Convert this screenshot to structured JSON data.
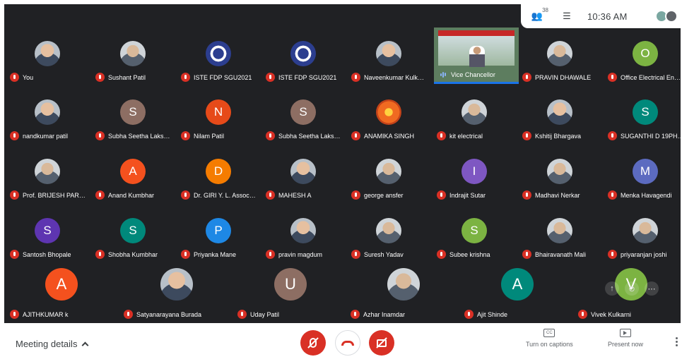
{
  "topbar": {
    "participants_icon": "people-icon",
    "participant_count": "38",
    "chat_icon": "chat-icon",
    "time": "10:36 AM",
    "self_avatars": [
      "#7aa7a1",
      "#5f6368"
    ]
  },
  "presenter": {
    "name": "Vice Chancellor",
    "icon": "speaking-eq-icon"
  },
  "participants": [
    {
      "name": "You",
      "avatar": "photo"
    },
    {
      "name": "Sushant Patil",
      "avatar": "gray-photo"
    },
    {
      "name": "ISTE FDP SGU2021",
      "avatar": "emblem"
    },
    {
      "name": "ISTE FDP SGU2021",
      "avatar": "emblem"
    },
    {
      "name": "Naveenkumar Kulk…",
      "avatar": "photo"
    },
    null,
    {
      "name": "PRAVIN DHAWALE",
      "avatar": "gray-photo"
    },
    {
      "name": "Office Electrical En…",
      "initial": "O",
      "color": "#7cb342"
    },
    {
      "name": "nandkumar patil",
      "avatar": "photo"
    },
    {
      "name": "Subha Seetha Laks…",
      "initial": "S",
      "color": "#8d6e63"
    },
    {
      "name": "Nilam Patil",
      "initial": "N",
      "color": "#e64a19"
    },
    {
      "name": "Subha Seetha Laks…",
      "initial": "S",
      "color": "#8d6e63"
    },
    {
      "name": "ANAMIKA SINGH",
      "avatar": "flower"
    },
    {
      "name": "kit electrical",
      "avatar": "gray-photo"
    },
    {
      "name": "Kshitij Bhargava",
      "avatar": "photo"
    },
    {
      "name": "SUGANTHI D 19PH…",
      "initial": "S",
      "color": "#00897b"
    },
    {
      "name": "Prof. BRIJESH PAR…",
      "avatar": "gray-photo"
    },
    {
      "name": "Anand Kumbhar",
      "initial": "A",
      "color": "#f4511e"
    },
    {
      "name": "Dr. GIRI Y. L. Assoc…",
      "initial": "D",
      "color": "#f57c00"
    },
    {
      "name": "MAHESH A",
      "avatar": "photo"
    },
    {
      "name": "george ansfer",
      "avatar": "gray-photo"
    },
    {
      "name": "Indrajit Sutar",
      "initial": "I",
      "color": "#7e57c2"
    },
    {
      "name": "Madhavi Nerkar",
      "avatar": "gray-photo"
    },
    {
      "name": "Menka Havagendi",
      "initial": "M",
      "color": "#5c6bc0"
    },
    {
      "name": "Santosh Bhopale",
      "initial": "S",
      "color": "#5e35b1"
    },
    {
      "name": "Shobha Kumbhar",
      "initial": "S",
      "color": "#00897b"
    },
    {
      "name": "Priyanka Mane",
      "initial": "P",
      "color": "#1e88e5"
    },
    {
      "name": "pravin magdum",
      "avatar": "photo"
    },
    {
      "name": "Suresh Yadav",
      "avatar": "gray-photo"
    },
    {
      "name": "Subee krishna",
      "initial": "S",
      "color": "#7cb342"
    },
    {
      "name": "Bhairavanath Mali",
      "avatar": "gray-photo"
    },
    {
      "name": "priyaranjan joshi",
      "avatar": "gray-photo"
    }
  ],
  "bottom_participants": [
    {
      "name": "AJITHKUMAR k",
      "initial": "A",
      "color": "#f4511e"
    },
    {
      "name": "Satyanarayana Burada",
      "avatar": "photo"
    },
    {
      "name": "Uday Patil",
      "initial": "U",
      "color": "#8d6e63"
    },
    {
      "name": "Azhar Inamdar",
      "avatar": "gray-photo"
    },
    {
      "name": "Ajit Shinde",
      "initial": "A",
      "color": "#00897b"
    },
    {
      "name": "Vivek Kulkarni",
      "initial": "V",
      "color": "#7cb342"
    }
  ],
  "tile_overlay": [
    "pin-icon",
    "mute-icon",
    "more-icon"
  ],
  "controls": {
    "meeting_details": "Meeting details",
    "mic_icon": "mic-off-icon",
    "hangup_icon": "hangup-icon",
    "camera_icon": "camera-off-icon",
    "captions_label": "Turn on captions",
    "present_label": "Present now",
    "cc_glyph": "CC"
  }
}
